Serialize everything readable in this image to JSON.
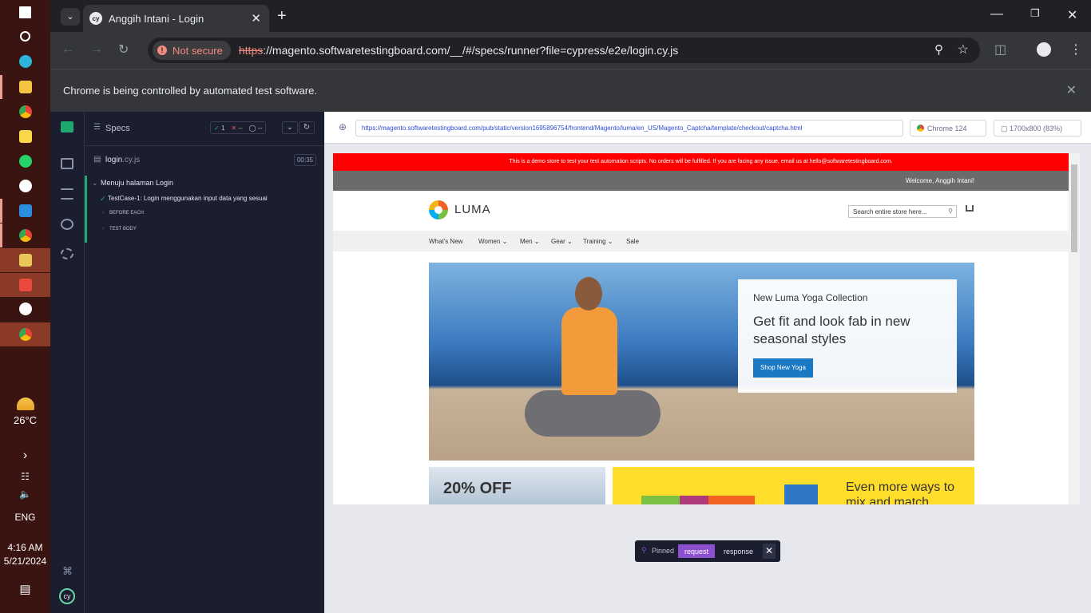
{
  "taskbar": {
    "weather_temp": "26°C",
    "language": "ENG",
    "time": "4:16 AM",
    "date": "5/21/2024"
  },
  "browser": {
    "tab_title": "Anggih Intani - Login",
    "security_label": "Not secure",
    "url_scheme": "https",
    "url_rest": "://magento.softwaretestingboard.com/__/#/specs/runner?file=cypress/e2e/login.cy.js",
    "infobar_text": "Chrome is being controlled by automated test software."
  },
  "reporter": {
    "specs_label": "Specs",
    "passed": "1",
    "failed": "--",
    "pending": "--",
    "file_name": "login",
    "file_ext": ".cy.js",
    "duration": "00:35",
    "suite_title": "Menuju halaman Login",
    "test_title": "TestCase-1: Login menggunakan input data yang sesuai",
    "hook_before": "BEFORE EACH",
    "hook_body": "TEST BODY"
  },
  "aut": {
    "url": "https://magento.softwaretestingboard.com/pub/static/version1695896754/frontend/Magento/luma/en_US/Magento_Captcha/template/checkout/captcha.html",
    "browser": "Chrome 124",
    "viewport": "1700x800 (83%)"
  },
  "site": {
    "notice": "This is a demo store to test your test automation scripts. No orders will be fulfilled. If you are facing any issue, email us at hello@softwaretestingboard.com.",
    "welcome": "Welcome, Anggih Intani!",
    "logo_text": "LUMA",
    "search_placeholder": "Search entire store here...",
    "nav": [
      "What's New",
      "Women",
      "Men",
      "Gear",
      "Training",
      "Sale"
    ],
    "promo_small": "New Luma Yoga Collection",
    "promo_big": "Get fit and look fab in new seasonal styles",
    "promo_button": "Shop New Yoga",
    "tile1_text": "20% OFF",
    "tile2_text": "Even more ways to mix and match"
  },
  "pinned": {
    "label": "Pinned",
    "request": "request",
    "response": "response"
  }
}
